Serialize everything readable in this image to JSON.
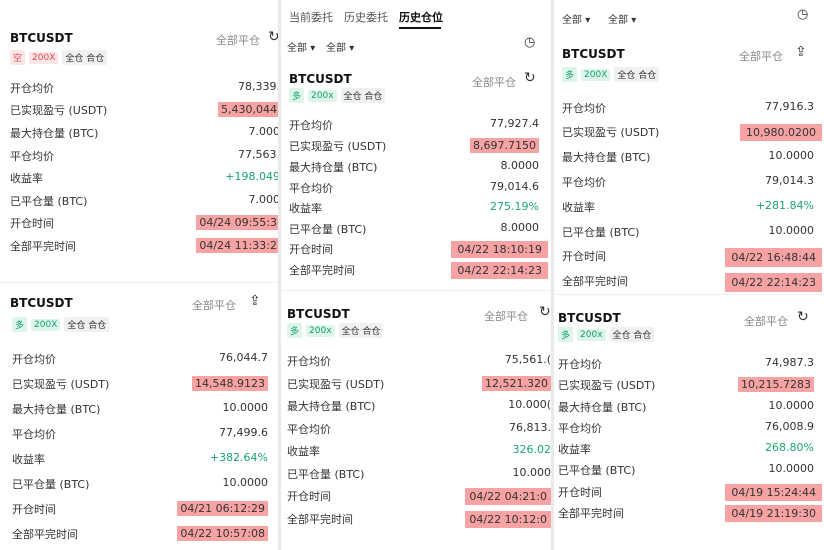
{
  "tabs": [
    "当前委托",
    "历史委托",
    "历史仓位"
  ],
  "filters": {
    "all_1": "全部",
    "all_2": "全部"
  },
  "labels": {
    "close_all": "全部平仓",
    "mode": "全仓 合仓",
    "avg_open": "开仓均价",
    "realized_pnl": "已实现盈亏 (USDT)",
    "max_pos": "最大持仓量 (BTC)",
    "avg_close": "平仓均价",
    "roi": "收益率",
    "closed_qty": "已平仓量 (BTC)",
    "open_time": "开仓时间",
    "close_time": "全部平完时间"
  },
  "colors": {
    "short": "#e0454e",
    "long": "#12a06c",
    "highlight": "#f8a3a3",
    "green_text": "#1ba66c"
  },
  "cards": [
    {
      "symbol": "BTCUSDT",
      "side": "空",
      "side_type": "short",
      "leverage": "200X",
      "avg_open": "78,339.",
      "realized_pnl": "5,430,044",
      "max_pos": "7.000",
      "avg_close": "77,563.",
      "roi": "+198.049",
      "closed_qty": "7.000",
      "open_time": "04/24 09:55:3",
      "close_time": "04/24 11:33:2"
    },
    {
      "symbol": "BTCUSDT",
      "side": "多",
      "side_type": "long",
      "leverage": "200X",
      "avg_open": "76,044.7",
      "realized_pnl": "14,548.9123",
      "max_pos": "10.0000",
      "avg_close": "77,499.6",
      "roi": "+382.64%",
      "closed_qty": "10.0000",
      "open_time": "04/21 06:12:29",
      "close_time": "04/22 10:57:08"
    },
    {
      "symbol": "BTCUSDT",
      "side": "多",
      "side_type": "long",
      "leverage": "200x",
      "avg_open": "77,927.4",
      "realized_pnl": "8,697.7150",
      "max_pos": "8.0000",
      "avg_close": "79,014.6",
      "roi": "275.19%",
      "closed_qty": "8.0000",
      "open_time": "04/22 18:10:19",
      "close_time": "04/22 22:14:23"
    },
    {
      "symbol": "BTCUSDT",
      "side": "多",
      "side_type": "long",
      "leverage": "200x",
      "avg_open": "75,561.(",
      "realized_pnl": "12,521.320",
      "max_pos": "10.000(",
      "avg_close": "76,813.",
      "roi": "326.02",
      "closed_qty": "10.000",
      "open_time": "04/22 04:21:0",
      "close_time": "04/22 10:12:0"
    },
    {
      "symbol": "BTCUSDT",
      "side": "多",
      "side_type": "long",
      "leverage": "200X",
      "avg_open": "77,916.3",
      "realized_pnl": "10,980.0200",
      "max_pos": "10.0000",
      "avg_close": "79,014.3",
      "roi": "+281.84%",
      "closed_qty": "10.0000",
      "open_time": "04/22 16:48:44",
      "close_time": "04/22 22:14:23"
    },
    {
      "symbol": "BTCUSDT",
      "side": "多",
      "side_type": "long",
      "leverage": "200x",
      "avg_open": "74,987.3",
      "realized_pnl": "10,215.7283",
      "max_pos": "10.0000",
      "avg_close": "76,008.9",
      "roi": "268.80%",
      "closed_qty": "10.0000",
      "open_time": "04/19 15:24:44",
      "close_time": "04/19 21:19:30"
    }
  ]
}
